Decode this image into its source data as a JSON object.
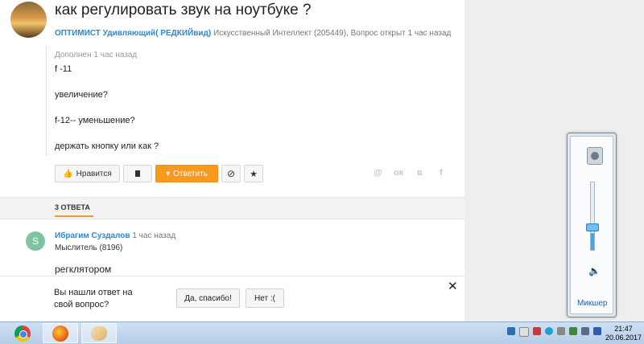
{
  "question": {
    "title": "как регулировать звук на ноутбуке ?",
    "author": "ОПТИМИСТ Удивляющий( РЕДКИЙвид)",
    "author_info": "Искусственный Интеллект (205449), Вопрос открыт 1 час назад",
    "supplement_label": "Дополнен 1 час назад",
    "supplement_lines": [
      "f -11",
      "увеличение?",
      "f-12-- уменьшение?",
      "держать кнопку или как ?"
    ]
  },
  "actions": {
    "like_label": "Нравится",
    "answer_label": "Ответить"
  },
  "share_icons": [
    "@",
    "ок",
    "в",
    "f"
  ],
  "answers_tab": {
    "label": "3 ОТВЕТА"
  },
  "answer": {
    "avatar_letter": "S",
    "author": "Ибрагим Суздалов",
    "time": "1 час назад",
    "rank": "Мыслитель (8196)",
    "text": "регклятором"
  },
  "prompt": {
    "line1": "Вы нашли ответ на",
    "line2": "свой вопрос?",
    "yes_label": "Да, спасибо!",
    "no_label": "Нет :(",
    "close_symbol": "✕"
  },
  "volume": {
    "level": 0.25,
    "mixer_label": "Микшер"
  },
  "taskbar": {
    "time": "21:47",
    "date": "20.06.2017"
  }
}
